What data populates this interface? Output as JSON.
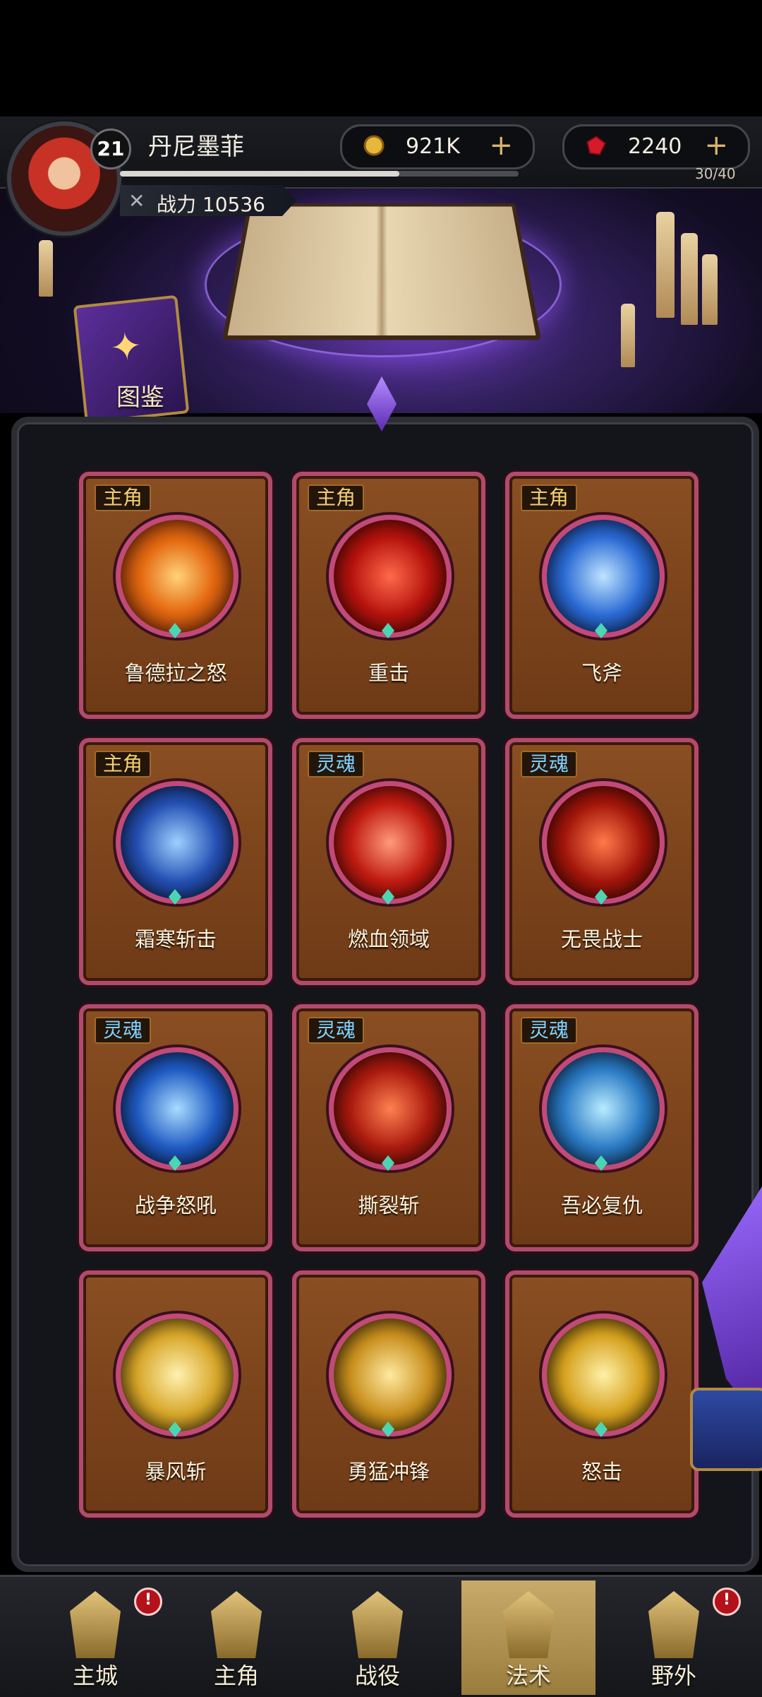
{
  "player": {
    "level": "21",
    "name": "丹尼墨菲",
    "power_label": "战力 10536",
    "xp_fraction": 0.7
  },
  "currency": {
    "gold": "921K",
    "gems": "2240",
    "plus": "+"
  },
  "energy": "30/40",
  "atlas_label": "图鉴",
  "colors": {
    "hero_tag": "#f5d06e",
    "soul_tag": "#7ed1ff",
    "card_border": "#b24a6e",
    "card_bg": "#7a431b",
    "active_nav": "#c8aa6a"
  },
  "skills": [
    {
      "tag": "主角",
      "tag_type": "hero",
      "name": "鲁德拉之怒",
      "icon": "flame-icon",
      "orb": "radial-gradient(circle,#ffd27a,#e46a12 45%,#5a1606)"
    },
    {
      "tag": "主角",
      "tag_type": "hero",
      "name": "重击",
      "icon": "slash-icon",
      "orb": "radial-gradient(circle,#ff6a4a,#b4120c 50%,#3a0505)"
    },
    {
      "tag": "主角",
      "tag_type": "hero",
      "name": "飞斧",
      "icon": "axe-icon",
      "orb": "radial-gradient(circle,#bfe4ff,#2a6ad4 50%,#0b1a45)"
    },
    {
      "tag": "主角",
      "tag_type": "hero",
      "name": "霜寒斩击",
      "icon": "frost-icon",
      "orb": "radial-gradient(circle,#9fd0ff,#2450b3 50%,#0a1535)"
    },
    {
      "tag": "灵魂",
      "tag_type": "soul",
      "name": "燃血领域",
      "icon": "blood-fist-icon",
      "orb": "radial-gradient(circle,#ff9a7a,#c01a10 50%,#3d0606)"
    },
    {
      "tag": "灵魂",
      "tag_type": "soul",
      "name": "无畏战士",
      "icon": "sword-icon",
      "orb": "radial-gradient(circle,#ff7a4a,#a2150a 50%,#2e0404)"
    },
    {
      "tag": "灵魂",
      "tag_type": "soul",
      "name": "战争怒吼",
      "icon": "roar-icon",
      "orb": "radial-gradient(circle,#a9dcff,#1f5ac2 50%,#081535)"
    },
    {
      "tag": "灵魂",
      "tag_type": "soul",
      "name": "撕裂斩",
      "icon": "crescent-slash-icon",
      "orb": "radial-gradient(circle,#ff8050,#aa1a0e 50%,#300505)"
    },
    {
      "tag": "灵魂",
      "tag_type": "soul",
      "name": "吾必复仇",
      "icon": "eye-icon",
      "orb": "radial-gradient(circle,#b8ecff,#2a7ac4 50%,#0a1f3c)"
    },
    {
      "tag": "",
      "tag_type": "none",
      "name": "暴风斩",
      "icon": "storm-blade-icon",
      "orb": "radial-gradient(circle,#fff1b0,#d8a72a 50%,#3a2a05)"
    },
    {
      "tag": "",
      "tag_type": "none",
      "name": "勇猛冲锋",
      "icon": "charge-icon",
      "orb": "radial-gradient(circle,#ffe9a0,#c9901e 50%,#2e1f04)"
    },
    {
      "tag": "",
      "tag_type": "none",
      "name": "怒击",
      "icon": "moon-strike-icon",
      "orb": "radial-gradient(circle,#fff0a8,#d6a21f 50%,#2a1c03)"
    }
  ],
  "nav": [
    {
      "label": "主城",
      "icon": "castle-icon",
      "badge": "!"
    },
    {
      "label": "主角",
      "icon": "hero-icon",
      "badge": ""
    },
    {
      "label": "战役",
      "icon": "battle-icon",
      "badge": ""
    },
    {
      "label": "法术",
      "icon": "spell-icon",
      "badge": "",
      "active": true
    },
    {
      "label": "野外",
      "icon": "wild-eye-icon",
      "badge": "!"
    }
  ]
}
